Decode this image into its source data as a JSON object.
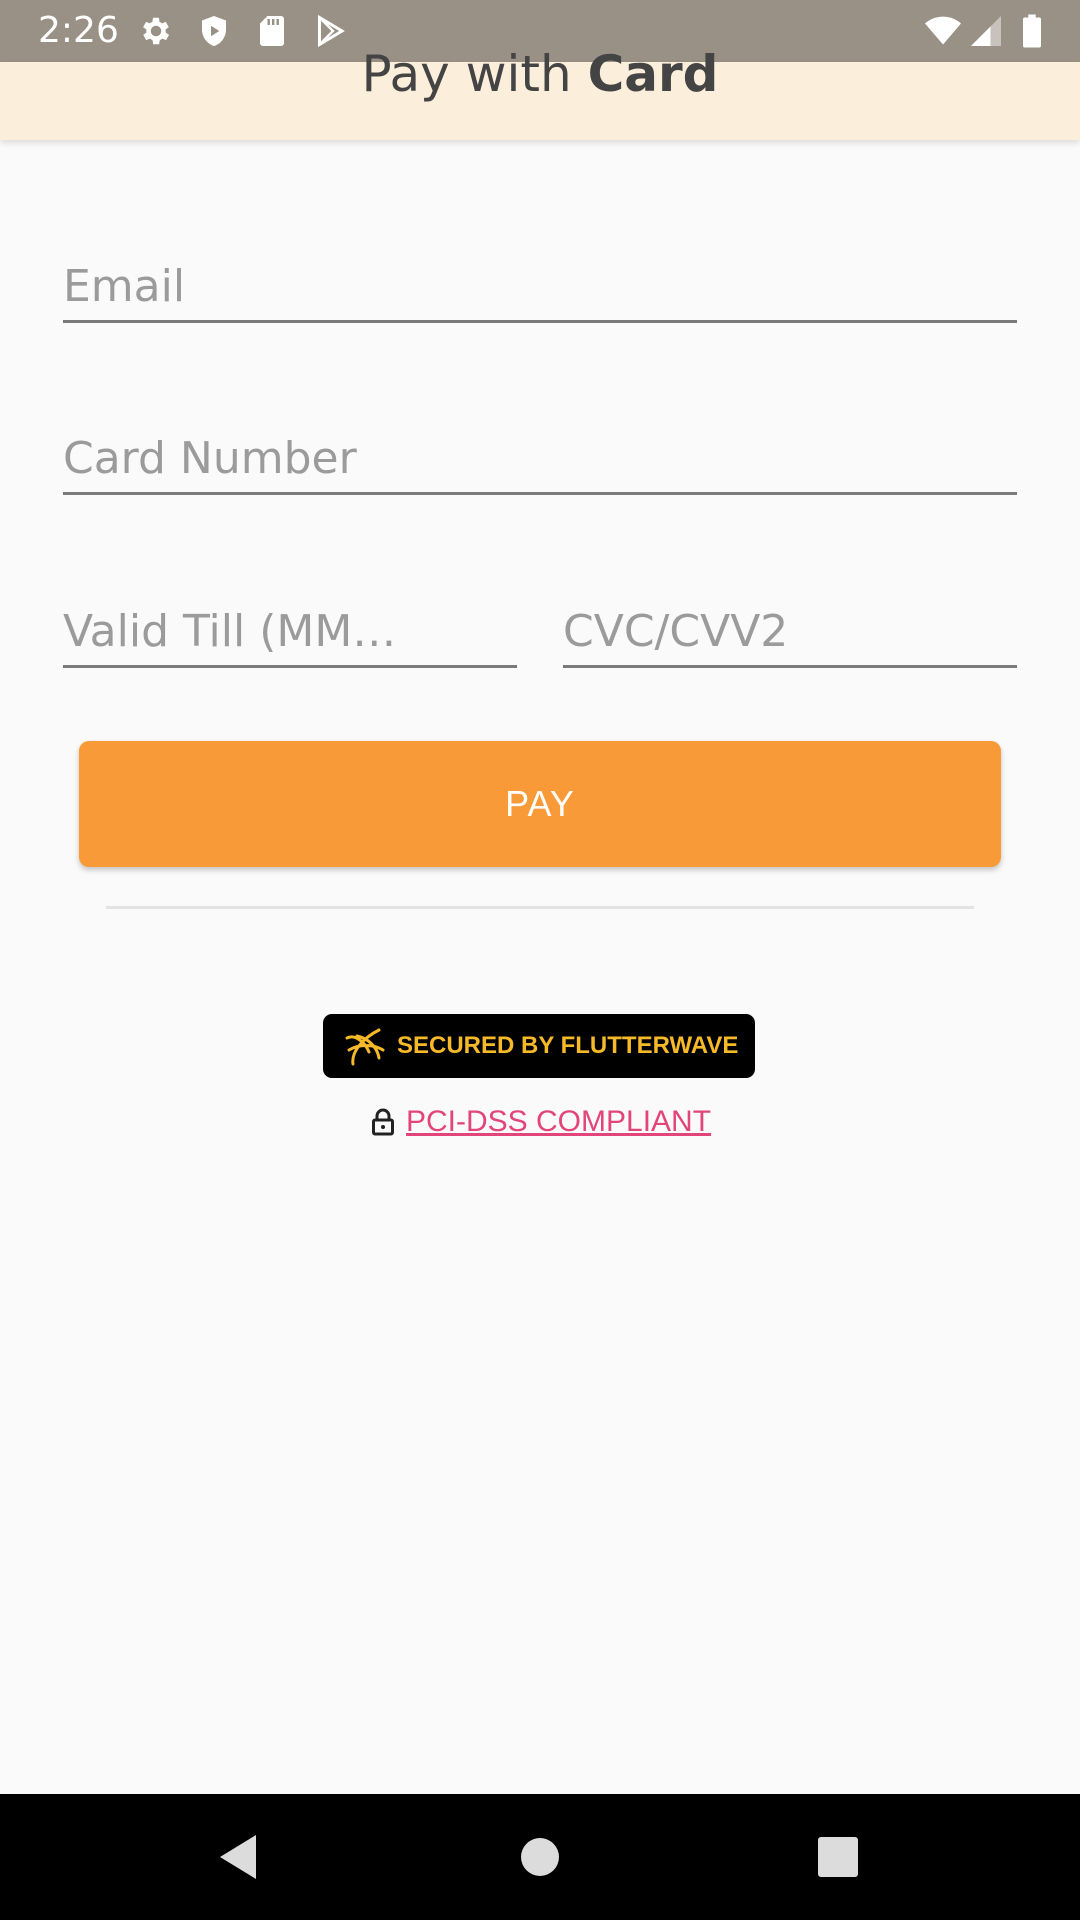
{
  "status_bar": {
    "time": "2:26",
    "left_icons": [
      "settings-icon",
      "shield-icon",
      "sd-card-icon",
      "play-store-icon"
    ],
    "right_icons": [
      "wifi-icon",
      "cell-signal-icon",
      "battery-icon"
    ]
  },
  "app_bar": {
    "title_prefix": "Pay with ",
    "title_bold": "Card",
    "background": "#fbeeda"
  },
  "form": {
    "email_placeholder": "Email",
    "email_value": "",
    "card_number_placeholder": "Card Number",
    "card_number_value": "",
    "valid_till_placeholder": "Valid Till (MM…",
    "valid_till_value": "",
    "cvc_placeholder": "CVC/CVV2",
    "cvc_value": ""
  },
  "pay_button": {
    "label": "PAY",
    "color": "#f89a38"
  },
  "badge": {
    "text": "SECURED BY FLUTTERWAVE",
    "icon": "flutterwave-logo-icon",
    "text_color": "#f6b928"
  },
  "pci": {
    "icon": "lock-icon",
    "link_text": "PCI-DSS COMPLIANT",
    "link_color": "#e2457a"
  },
  "nav_bar": {
    "buttons": [
      "back-icon",
      "home-icon",
      "recents-icon"
    ]
  }
}
